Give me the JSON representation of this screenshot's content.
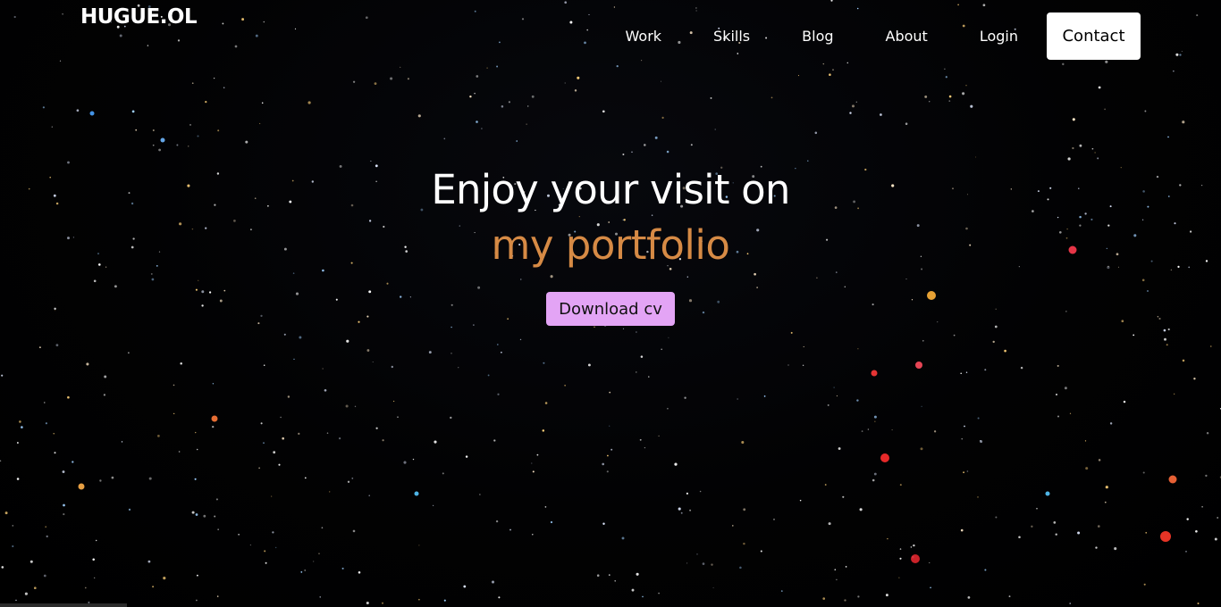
{
  "header": {
    "logo": "HUGUE.OL",
    "nav": [
      "Work",
      "Skills",
      "Blog",
      "About",
      "Login"
    ],
    "contact_label": "Contact"
  },
  "hero": {
    "line1": "Enjoy your visit on",
    "line2": "my portfolio",
    "cv_label": "Download cv"
  },
  "colors": {
    "background": "#000000",
    "accent": "#d68a45",
    "cv_button": "#e3a4f5",
    "contact_button": "#ffffff"
  }
}
